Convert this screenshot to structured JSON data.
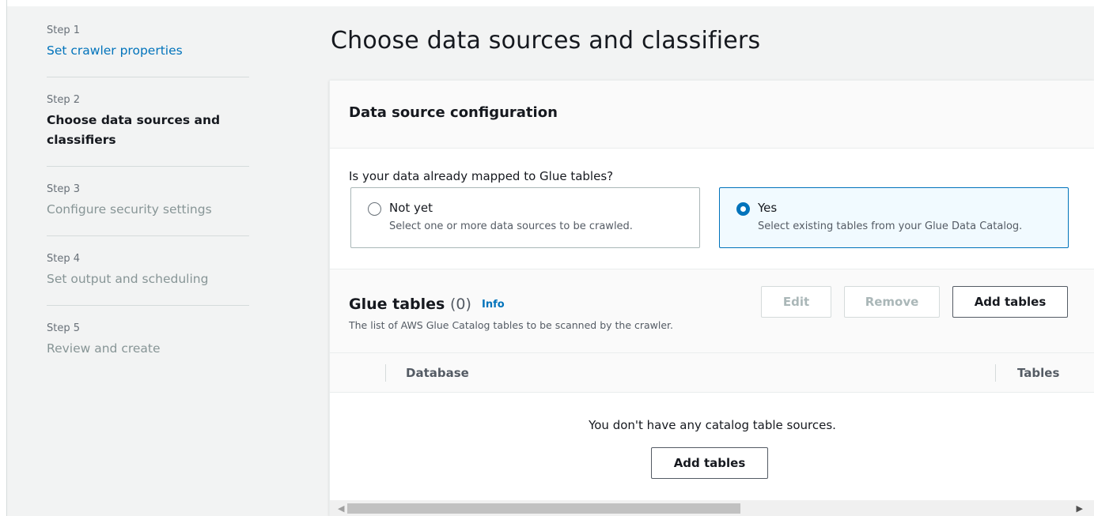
{
  "steps": [
    {
      "num": "Step 1",
      "title": "Set crawler properties"
    },
    {
      "num": "Step 2",
      "title": "Choose data sources and classifiers"
    },
    {
      "num": "Step 3",
      "title": "Configure security settings"
    },
    {
      "num": "Step 4",
      "title": "Set output and scheduling"
    },
    {
      "num": "Step 5",
      "title": "Review and create"
    }
  ],
  "page_title": "Choose data sources and classifiers",
  "config": {
    "heading": "Data source configuration",
    "question": "Is your data already mapped to Glue tables?",
    "options": [
      {
        "label": "Not yet",
        "desc": "Select one or more data sources to be crawled.",
        "selected": false
      },
      {
        "label": "Yes",
        "desc": "Select existing tables from your Glue Data Catalog.",
        "selected": true
      }
    ]
  },
  "glue_tables": {
    "title": "Glue tables",
    "count": "(0)",
    "info": "Info",
    "desc": "The list of AWS Glue Catalog tables to be scanned by the crawler.",
    "edit_label": "Edit",
    "remove_label": "Remove",
    "add_label": "Add tables"
  },
  "table": {
    "columns": [
      "Database",
      "Tables"
    ],
    "empty_text": "You don't have any catalog table sources.",
    "empty_add_label": "Add tables"
  },
  "colors": {
    "accent": "#0073bb",
    "background": "#f2f3f3"
  }
}
